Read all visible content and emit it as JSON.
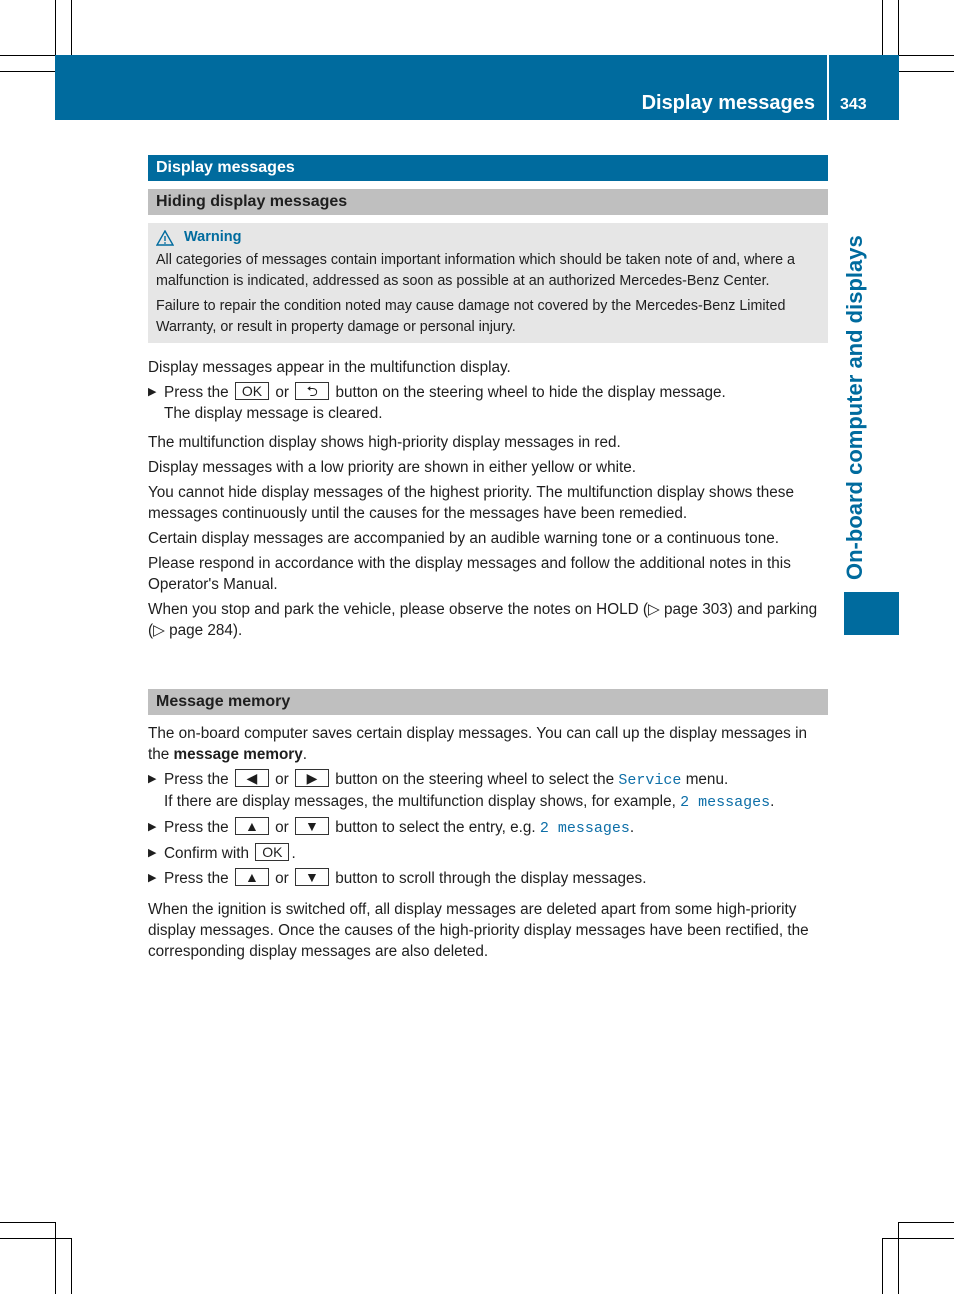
{
  "header": {
    "title": "Display messages",
    "page_number": "343"
  },
  "side_tab": {
    "label": "On-board computer and displays"
  },
  "section": {
    "title": "Display messages"
  },
  "hiding": {
    "title": "Hiding display messages",
    "warning": {
      "label": "Warning",
      "p1": "All categories of messages contain important information which should be taken note of and, where a malfunction is indicated, addressed as soon as possible at an authorized Mercedes-Benz Center.",
      "p2": "Failure to repair the condition noted may cause damage not covered by the Mercedes-Benz Limited Warranty, or result in property damage or personal injury."
    },
    "intro": "Display messages appear in the multifunction display.",
    "step1": {
      "pre": "Press the",
      "key1": "OK",
      "or": "or",
      "key2": "⮌",
      "post": "button on the steering wheel to hide the display message.",
      "result": "The display message is cleared."
    },
    "paras": [
      "The multifunction display shows high-priority display messages in red.",
      "Display messages with a low priority are shown in either yellow or white.",
      "You cannot hide display messages of the highest priority. The multifunction display shows these messages continuously until the causes for the messages have been remedied.",
      "Certain display messages are accompanied by an audible warning tone or a continuous tone.",
      "Please respond in accordance with the display messages and follow the additional notes in this Operator's Manual.",
      "When you stop and park the vehicle, please observe the notes on HOLD (▷ page 303) and parking (▷ page 284)."
    ]
  },
  "memory": {
    "title": "Message memory",
    "intro_pre": "The on-board computer saves certain display messages. You can call up the display messages in the ",
    "intro_bold": "message memory",
    "intro_post": ".",
    "s1": {
      "pre": "Press the",
      "k1": "◀",
      "or": "or",
      "k2": "▶",
      "mid": "button on the steering wheel to select the",
      "mono": "Service",
      "post": "menu.",
      "res_pre": "If there are display messages, the multifunction display shows, for example,",
      "res_mono": "2 messages",
      "res_post": "."
    },
    "s2": {
      "pre": "Press the",
      "k1": "▲",
      "or": "or",
      "k2": "▼",
      "mid": "button to select the entry, e.g.",
      "mono": "2 messages",
      "post": "."
    },
    "s3": {
      "pre": "Confirm with",
      "k1": "OK",
      "post": "."
    },
    "s4": {
      "pre": "Press the",
      "k1": "▲",
      "or": "or",
      "k2": "▼",
      "post": "button to scroll through the display messages."
    },
    "outro": "When the ignition is switched off, all display messages are deleted apart from some high-priority display messages. Once the causes of the high-priority display messages have been rectified, the corresponding display messages are also deleted."
  },
  "colors": {
    "accent": "#006b9e",
    "subheader": "#bfbfbf",
    "warning_bg": "#e6e6e6"
  }
}
